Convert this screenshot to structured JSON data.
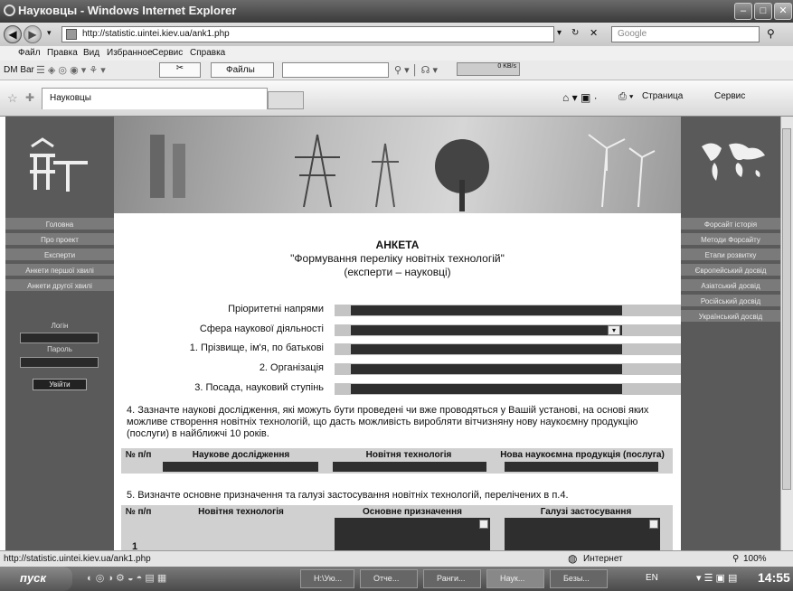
{
  "window": {
    "title": "Науковцы - Windows Internet Explorer"
  },
  "address": {
    "url": "http://statistic.uintei.kiev.ua/ank1.php",
    "search_placeholder": "Google"
  },
  "menu": [
    "Файл",
    "Правка",
    "Вид",
    "Избранное",
    "Сервис",
    "Справка"
  ],
  "toolbar": {
    "dm_bar": "DM Bar",
    "files": "Файлы",
    "progress": "0 KB/s"
  },
  "tabs": {
    "active": "Науковцы",
    "page_btn": "Страница",
    "service_btn": "Сервис"
  },
  "left_nav": [
    "Головна",
    "Про проект",
    "Експерти",
    "Анкети першої хвилі",
    "Анкети другої хвилі"
  ],
  "login": {
    "login_label": "Логін",
    "password_label": "Пароль",
    "enter": "Увійти"
  },
  "right_nav": [
    "Форсайт історія",
    "Методи Форсайту",
    "Етапи розвитку",
    "Європейський досвід",
    "Азіатський досвід",
    "Російський досвід",
    "Український досвід"
  ],
  "form": {
    "title": "АНКЕТА",
    "subtitle": "\"Формування переліку новітніх технологій\"",
    "subtitle2": "(експерти – науковці)",
    "fields": [
      "Пріоритетні напрями",
      "Сфера наукової діяльності",
      "1. Прізвище, ім'я, по батькові",
      "2. Організація",
      "3. Посада, науковий ступінь"
    ],
    "q4": "4. Зазначте наукові дослідження, які можуть бути проведені чи вже проводяться у Вашій установі, на основі яких можливе створення новітніх технологій, що дасть можливість виробляти вітчизняну нову наукоємну продукцію (послуги) в найближчі 10 років.",
    "table1": [
      "№ п/п",
      "Наукове дослідження",
      "Новітня технологія",
      "Нова наукоємна продукція (послуга)"
    ],
    "q5": "5. Визначте основне призначення та галузі застосування новітніх технологій, перелічених в п.4.",
    "table2": [
      "№ п/п",
      "Новітня технологія",
      "Основне призначення",
      "Галузі застосування"
    ],
    "row_num": "1"
  },
  "status": {
    "url": "http://statistic.uintei.kiev.ua/ank1.php",
    "zone": "Интернет",
    "zoom": "100%"
  },
  "taskbar": {
    "start": "пуск",
    "items": [
      "H:\\Ую...",
      "Отче...",
      "Ранги...",
      "Наук...",
      "Безы..."
    ],
    "lang": "EN",
    "time": "14:55"
  }
}
